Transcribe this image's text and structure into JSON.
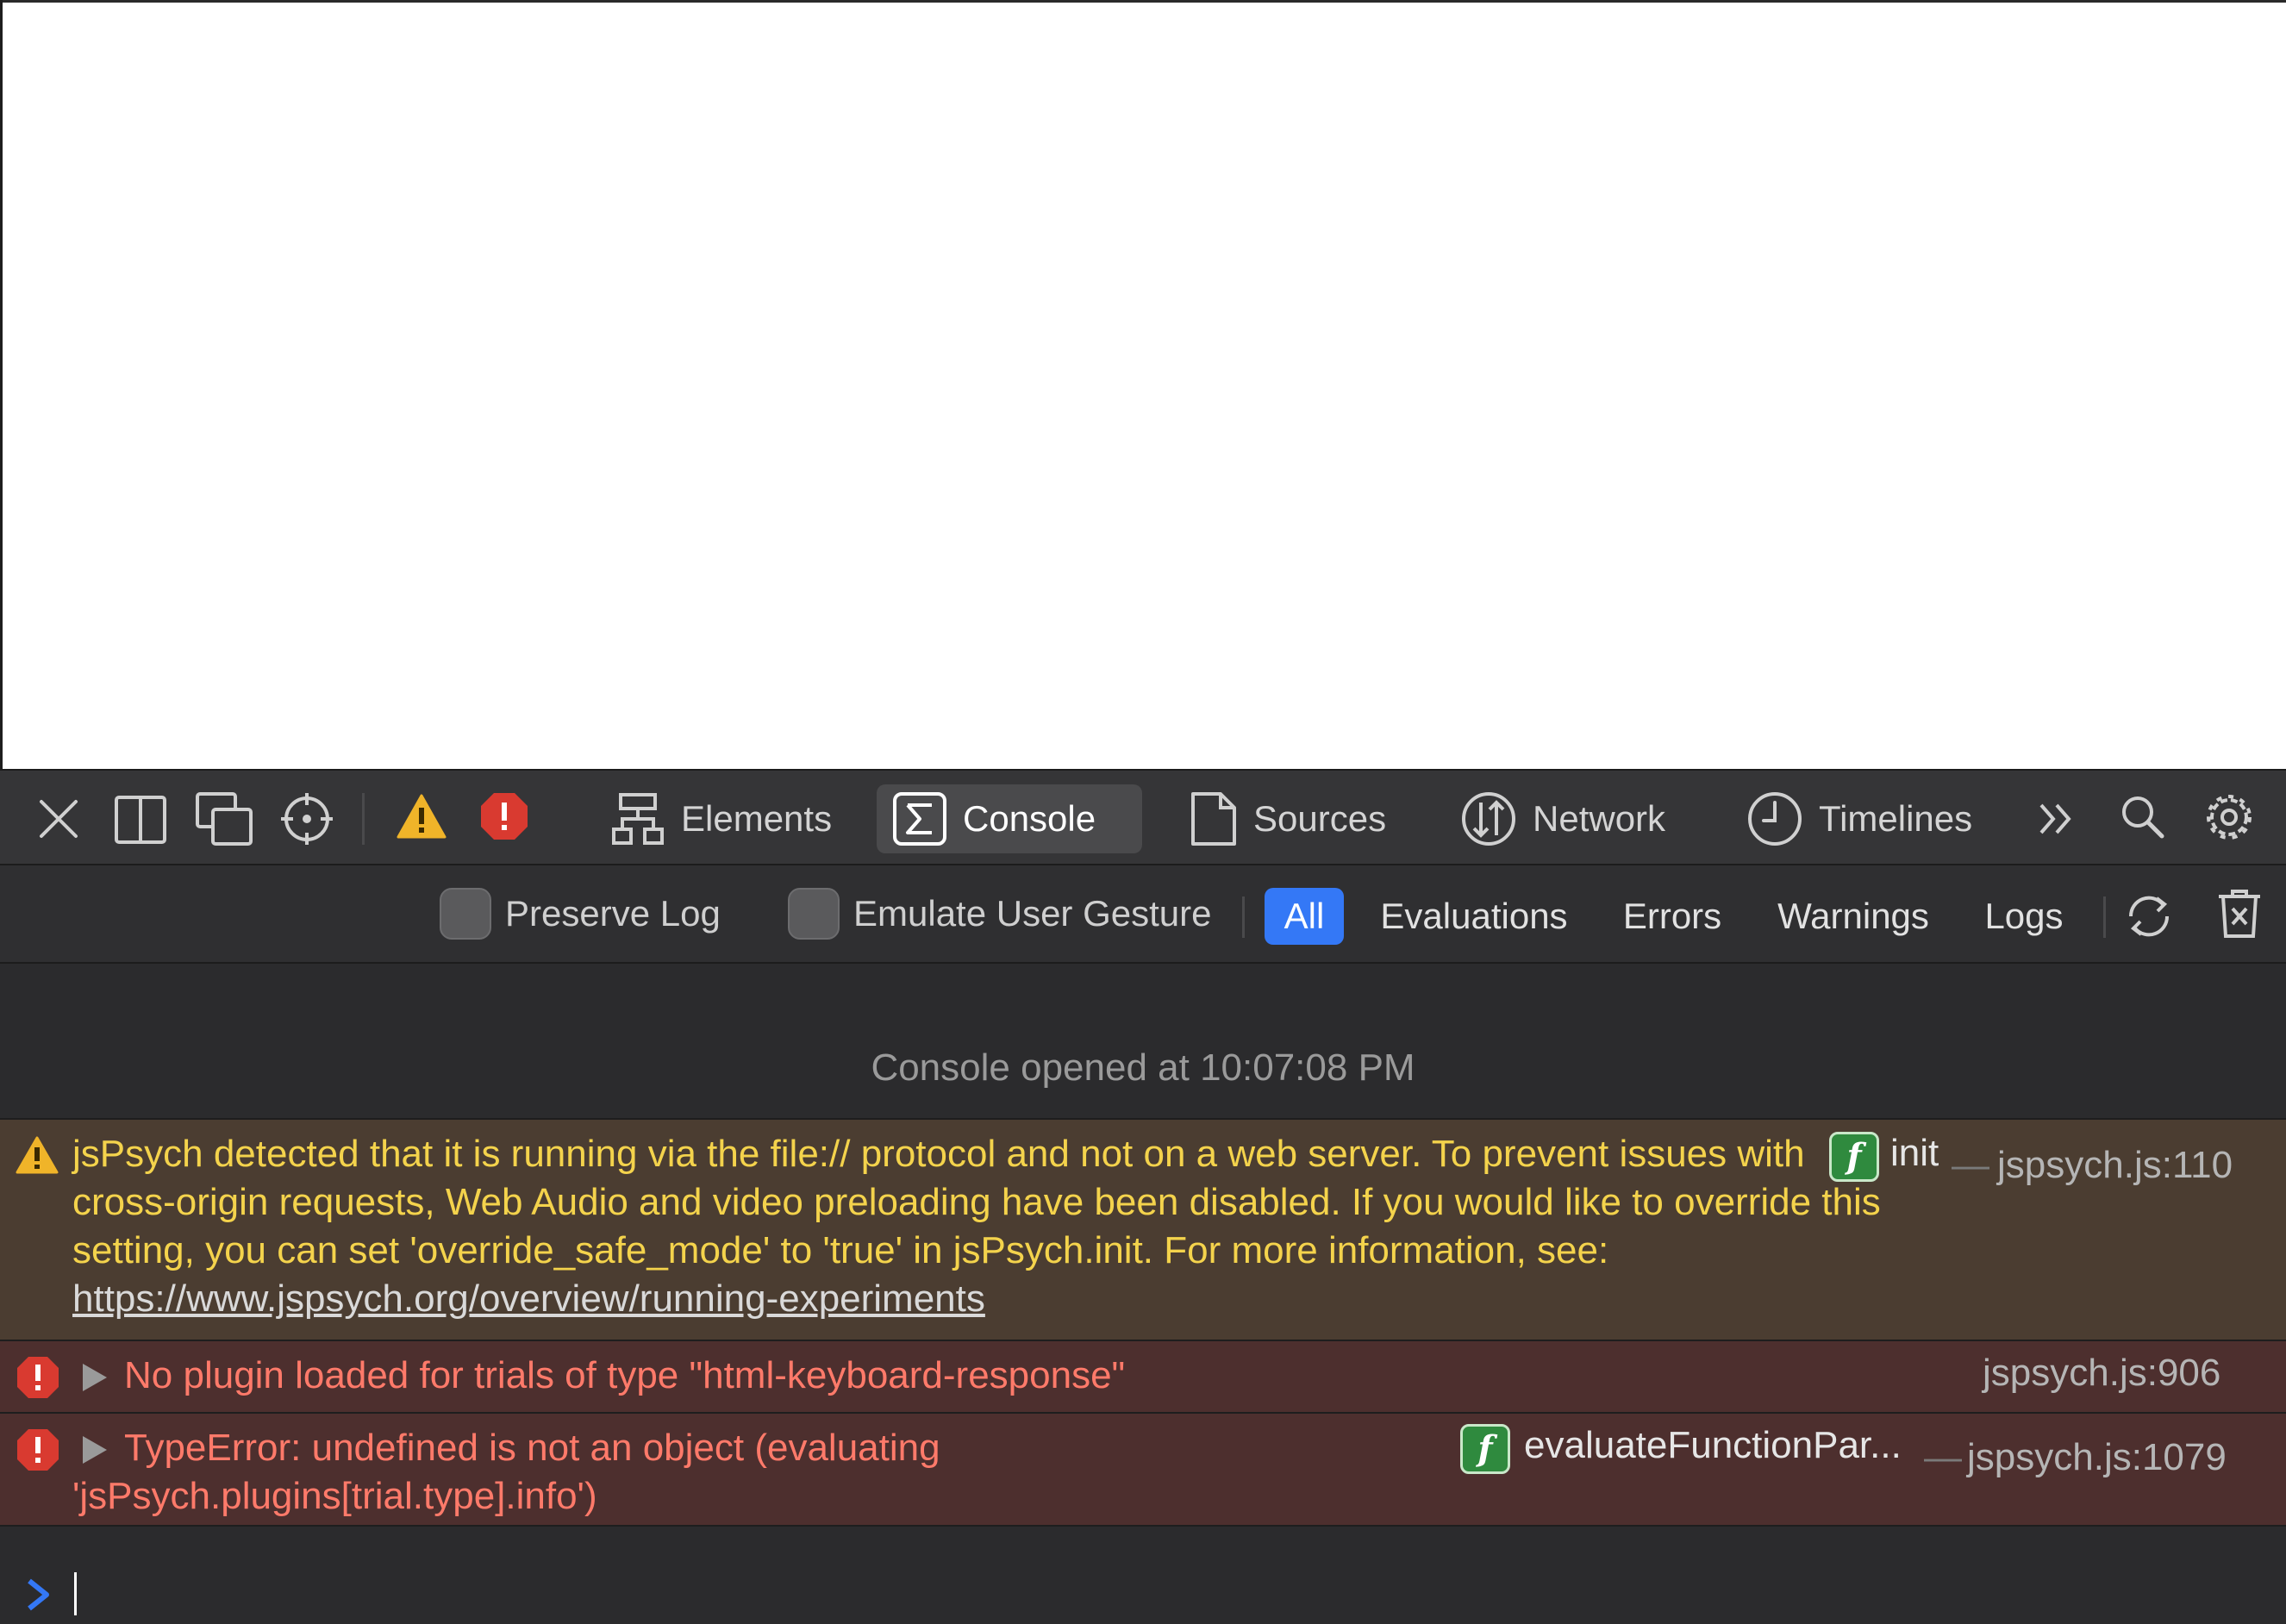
{
  "devtools": {
    "tabs": [
      {
        "label": "Elements",
        "icon": "elements-icon"
      },
      {
        "label": "Console",
        "icon": "console-icon",
        "active": true
      },
      {
        "label": "Sources",
        "icon": "document-icon"
      },
      {
        "label": "Network",
        "icon": "network-icon"
      },
      {
        "label": "Timelines",
        "icon": "clock-icon"
      }
    ],
    "filters": {
      "preserve_log": "Preserve Log",
      "emulate_gesture": "Emulate User Gesture",
      "all": "All",
      "evaluations": "Evaluations",
      "errors": "Errors",
      "warnings": "Warnings",
      "logs": "Logs"
    },
    "console": {
      "opened": "Console opened at 10:07:08 PM",
      "messages": [
        {
          "level": "warning",
          "text": "jsPsych detected that it is running via the file:// protocol and not on a web server. To prevent issues with cross-origin requests, Web Audio and video preloading have been disabled. If you would like to override this setting, you can set 'override_safe_mode' to 'true' in jsPsych.init. For more information, see:",
          "link": "https://www.jspsych.org/overview/running-experiments",
          "function": "init",
          "source": "jspsych.js:110"
        },
        {
          "level": "error",
          "text": "No plugin loaded for trials of type \"html-keyboard-response\"",
          "source": "jspsych.js:906"
        },
        {
          "level": "error",
          "text": "TypeError: undefined is not an object (evaluating",
          "text2": "'jsPsych.plugins[trial.type].info')",
          "function": "evaluateFunctionPar...",
          "source": "jspsych.js:1079"
        }
      ]
    },
    "colors": {
      "accent": "#3478f6",
      "warning_bg": "#4b3d31",
      "error_bg": "#4d2f2e",
      "warning_text": "#f4d34c",
      "error_text": "#ff7a6a"
    }
  }
}
